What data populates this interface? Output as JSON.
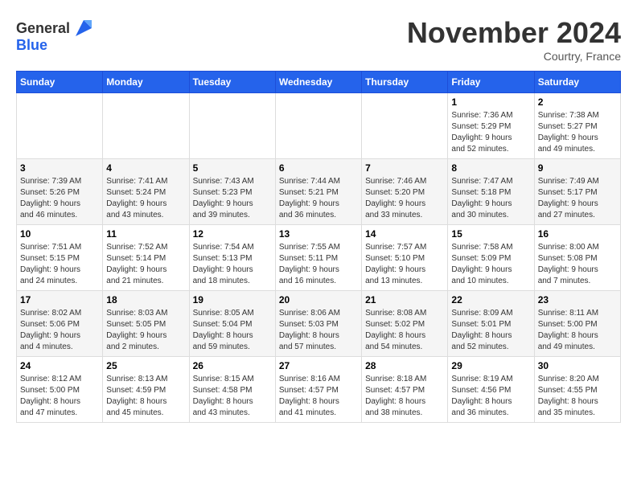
{
  "header": {
    "logo_line1": "General",
    "logo_line2": "Blue",
    "month_title": "November 2024",
    "location": "Courtry, France"
  },
  "weekdays": [
    "Sunday",
    "Monday",
    "Tuesday",
    "Wednesday",
    "Thursday",
    "Friday",
    "Saturday"
  ],
  "weeks": [
    [
      {
        "day": "",
        "info": ""
      },
      {
        "day": "",
        "info": ""
      },
      {
        "day": "",
        "info": ""
      },
      {
        "day": "",
        "info": ""
      },
      {
        "day": "",
        "info": ""
      },
      {
        "day": "1",
        "info": "Sunrise: 7:36 AM\nSunset: 5:29 PM\nDaylight: 9 hours\nand 52 minutes."
      },
      {
        "day": "2",
        "info": "Sunrise: 7:38 AM\nSunset: 5:27 PM\nDaylight: 9 hours\nand 49 minutes."
      }
    ],
    [
      {
        "day": "3",
        "info": "Sunrise: 7:39 AM\nSunset: 5:26 PM\nDaylight: 9 hours\nand 46 minutes."
      },
      {
        "day": "4",
        "info": "Sunrise: 7:41 AM\nSunset: 5:24 PM\nDaylight: 9 hours\nand 43 minutes."
      },
      {
        "day": "5",
        "info": "Sunrise: 7:43 AM\nSunset: 5:23 PM\nDaylight: 9 hours\nand 39 minutes."
      },
      {
        "day": "6",
        "info": "Sunrise: 7:44 AM\nSunset: 5:21 PM\nDaylight: 9 hours\nand 36 minutes."
      },
      {
        "day": "7",
        "info": "Sunrise: 7:46 AM\nSunset: 5:20 PM\nDaylight: 9 hours\nand 33 minutes."
      },
      {
        "day": "8",
        "info": "Sunrise: 7:47 AM\nSunset: 5:18 PM\nDaylight: 9 hours\nand 30 minutes."
      },
      {
        "day": "9",
        "info": "Sunrise: 7:49 AM\nSunset: 5:17 PM\nDaylight: 9 hours\nand 27 minutes."
      }
    ],
    [
      {
        "day": "10",
        "info": "Sunrise: 7:51 AM\nSunset: 5:15 PM\nDaylight: 9 hours\nand 24 minutes."
      },
      {
        "day": "11",
        "info": "Sunrise: 7:52 AM\nSunset: 5:14 PM\nDaylight: 9 hours\nand 21 minutes."
      },
      {
        "day": "12",
        "info": "Sunrise: 7:54 AM\nSunset: 5:13 PM\nDaylight: 9 hours\nand 18 minutes."
      },
      {
        "day": "13",
        "info": "Sunrise: 7:55 AM\nSunset: 5:11 PM\nDaylight: 9 hours\nand 16 minutes."
      },
      {
        "day": "14",
        "info": "Sunrise: 7:57 AM\nSunset: 5:10 PM\nDaylight: 9 hours\nand 13 minutes."
      },
      {
        "day": "15",
        "info": "Sunrise: 7:58 AM\nSunset: 5:09 PM\nDaylight: 9 hours\nand 10 minutes."
      },
      {
        "day": "16",
        "info": "Sunrise: 8:00 AM\nSunset: 5:08 PM\nDaylight: 9 hours\nand 7 minutes."
      }
    ],
    [
      {
        "day": "17",
        "info": "Sunrise: 8:02 AM\nSunset: 5:06 PM\nDaylight: 9 hours\nand 4 minutes."
      },
      {
        "day": "18",
        "info": "Sunrise: 8:03 AM\nSunset: 5:05 PM\nDaylight: 9 hours\nand 2 minutes."
      },
      {
        "day": "19",
        "info": "Sunrise: 8:05 AM\nSunset: 5:04 PM\nDaylight: 8 hours\nand 59 minutes."
      },
      {
        "day": "20",
        "info": "Sunrise: 8:06 AM\nSunset: 5:03 PM\nDaylight: 8 hours\nand 57 minutes."
      },
      {
        "day": "21",
        "info": "Sunrise: 8:08 AM\nSunset: 5:02 PM\nDaylight: 8 hours\nand 54 minutes."
      },
      {
        "day": "22",
        "info": "Sunrise: 8:09 AM\nSunset: 5:01 PM\nDaylight: 8 hours\nand 52 minutes."
      },
      {
        "day": "23",
        "info": "Sunrise: 8:11 AM\nSunset: 5:00 PM\nDaylight: 8 hours\nand 49 minutes."
      }
    ],
    [
      {
        "day": "24",
        "info": "Sunrise: 8:12 AM\nSunset: 5:00 PM\nDaylight: 8 hours\nand 47 minutes."
      },
      {
        "day": "25",
        "info": "Sunrise: 8:13 AM\nSunset: 4:59 PM\nDaylight: 8 hours\nand 45 minutes."
      },
      {
        "day": "26",
        "info": "Sunrise: 8:15 AM\nSunset: 4:58 PM\nDaylight: 8 hours\nand 43 minutes."
      },
      {
        "day": "27",
        "info": "Sunrise: 8:16 AM\nSunset: 4:57 PM\nDaylight: 8 hours\nand 41 minutes."
      },
      {
        "day": "28",
        "info": "Sunrise: 8:18 AM\nSunset: 4:57 PM\nDaylight: 8 hours\nand 38 minutes."
      },
      {
        "day": "29",
        "info": "Sunrise: 8:19 AM\nSunset: 4:56 PM\nDaylight: 8 hours\nand 36 minutes."
      },
      {
        "day": "30",
        "info": "Sunrise: 8:20 AM\nSunset: 4:55 PM\nDaylight: 8 hours\nand 35 minutes."
      }
    ]
  ]
}
